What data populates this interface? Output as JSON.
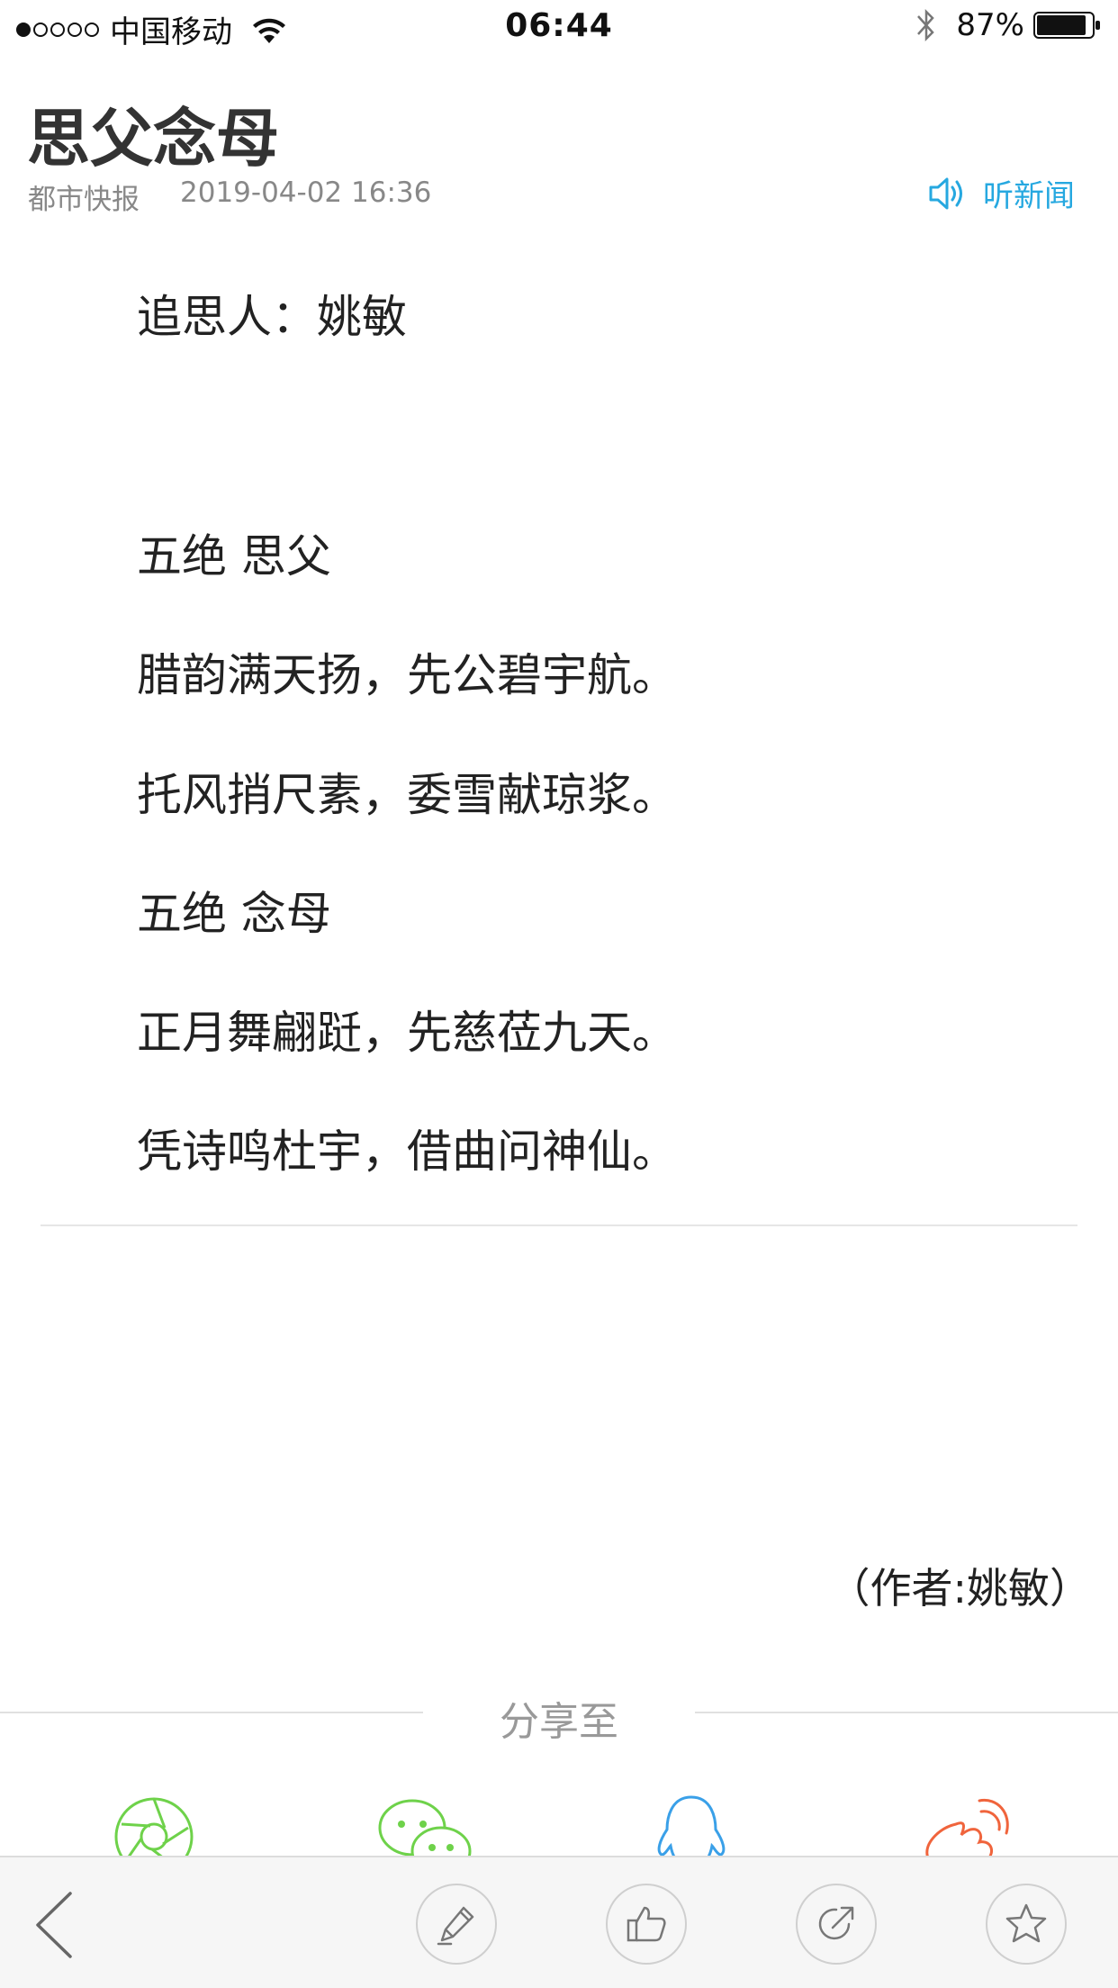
{
  "status_bar": {
    "carrier": "中国移动",
    "time": "06:44",
    "battery": "87%"
  },
  "article": {
    "title": "思父念母",
    "source": "都市快报",
    "date": "2019-04-02 16:36",
    "listen_label": "听新闻",
    "lines": [
      "追思人：姚敏",
      "五绝 思父",
      "腊韵满天扬，先公碧宇航。",
      "托风捎尺素，委雪献琼浆。",
      "五绝 念母",
      "正月舞翩跹，先慈莅九天。",
      "凭诗鸣杜宇，借曲问神仙。"
    ],
    "author": "（作者:姚敏）"
  },
  "share": {
    "label": "分享至",
    "targets": [
      "moments-icon",
      "wechat-icon",
      "qq-icon",
      "weibo-icon"
    ]
  },
  "toolbar": {
    "items": [
      "back-icon",
      "comment-icon",
      "like-icon",
      "share-icon",
      "favorite-icon"
    ]
  },
  "colors": {
    "accent": "#26a8e0",
    "moments": "#6ed24a",
    "wechat": "#6ed24a",
    "qq": "#3aa0e8",
    "weibo": "#f0643c"
  }
}
